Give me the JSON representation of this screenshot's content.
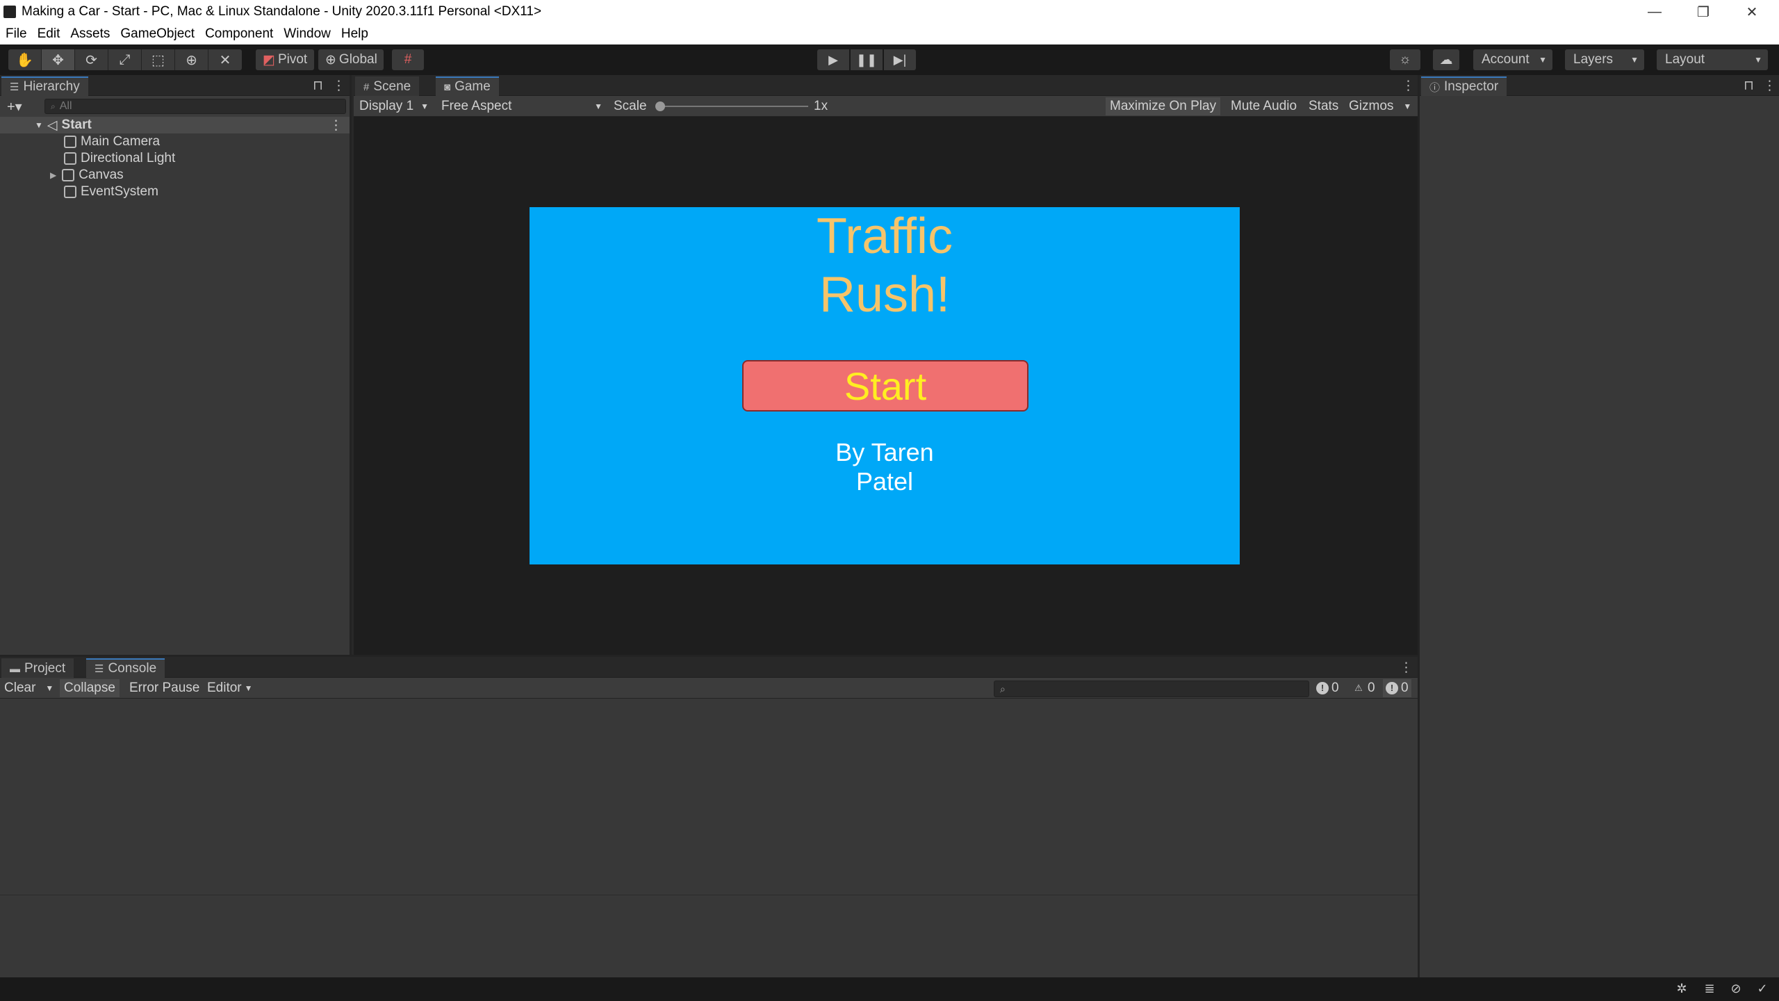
{
  "window": {
    "title": "Making a Car - Start - PC, Mac & Linux Standalone - Unity 2020.3.11f1 Personal <DX11>",
    "minimize": "—",
    "restore": "❐",
    "close": "✕"
  },
  "menu": [
    "File",
    "Edit",
    "Assets",
    "GameObject",
    "Component",
    "Window",
    "Help"
  ],
  "toolbar": {
    "tools": [
      "hand-tool-icon",
      "move-tool-icon",
      "rotate-tool-icon",
      "scale-tool-icon",
      "rect-tool-icon",
      "transform-tool-icon",
      "custom-tool-icon"
    ],
    "pivot_label": "Pivot",
    "global_label": "Global",
    "account_label": "Account",
    "layers_label": "Layers",
    "layout_label": "Layout"
  },
  "hierarchy": {
    "tab_label": "Hierarchy",
    "search_placeholder": "All",
    "scene_name": "Start",
    "items": [
      {
        "label": "Main Camera",
        "expandable": false
      },
      {
        "label": "Directional Light",
        "expandable": false
      },
      {
        "label": "Canvas",
        "expandable": true
      },
      {
        "label": "EventSystem",
        "expandable": false
      }
    ]
  },
  "gameview": {
    "tabs": [
      {
        "label": "Scene",
        "icon": "grid-icon",
        "active": false
      },
      {
        "label": "Game",
        "icon": "gamepad-icon",
        "active": true
      }
    ],
    "display": "Display 1",
    "aspect": "Free Aspect",
    "scale_label": "Scale",
    "scale_value": "1x",
    "maximize_label": "Maximize On Play",
    "mute_label": "Mute Audio",
    "stats_label": "Stats",
    "gizmos_label": "Gizmos",
    "game": {
      "title_line1": "Traffic",
      "title_line2": "Rush!",
      "start_label": "Start",
      "byline_line1": "By Taren",
      "byline_line2": "Patel",
      "bg_color": "#00a8f7",
      "title_color": "#f6c46a",
      "button_color": "#f07070",
      "button_text_color": "#ffee22"
    }
  },
  "inspector": {
    "tab_label": "Inspector"
  },
  "console": {
    "tabs": [
      {
        "label": "Project",
        "active": false
      },
      {
        "label": "Console",
        "active": true
      }
    ],
    "clear_label": "Clear",
    "collapse_label": "Collapse",
    "error_pause_label": "Error Pause",
    "editor_label": "Editor",
    "log_count": "0",
    "warning_count": "0",
    "error_count": "0"
  }
}
